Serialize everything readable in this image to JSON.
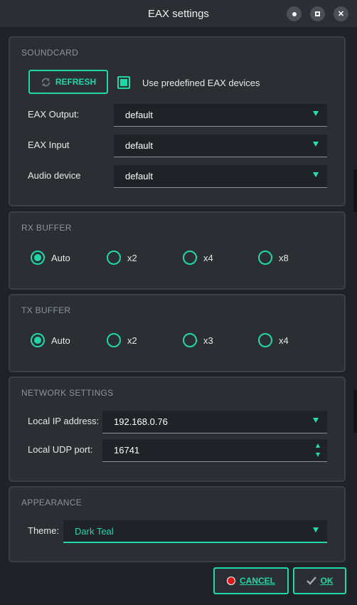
{
  "window": {
    "title": "EAX settings",
    "buttons": {
      "minimize": "●",
      "maximize": "■",
      "close": "✕"
    }
  },
  "soundcard": {
    "title": "SOUNDCARD",
    "refresh_label": "REFRESH",
    "use_predefined_label": "Use predefined EAX devices",
    "use_predefined_checked": true,
    "eax_output_label": "EAX Output:",
    "eax_output_value": "default",
    "eax_input_label": "EAX Input",
    "eax_input_value": "default",
    "audio_device_label": "Audio device",
    "audio_device_value": "default"
  },
  "rx_buffer": {
    "title": "RX BUFFER",
    "options": [
      "Auto",
      "x2",
      "x4",
      "x8"
    ],
    "selected": "Auto"
  },
  "tx_buffer": {
    "title": "TX BUFFER",
    "options": [
      "Auto",
      "x2",
      "x3",
      "x4"
    ],
    "selected": "Auto"
  },
  "network": {
    "title": "NETWORK SETTINGS",
    "ip_label": "Local IP address:",
    "ip_value": "192.168.0.76",
    "udp_label": "Local UDP port:",
    "udp_value": "16741"
  },
  "appearance": {
    "title": "APPEARANCE",
    "theme_label": "Theme:",
    "theme_value": "Dark Teal"
  },
  "dialog": {
    "cancel_label": "CANCEL",
    "ok_label": "OK"
  },
  "colors": {
    "accent": "#1ed8aa",
    "background": "#2b2f34",
    "field": "#1f2226",
    "cancel_icon": "#e01818"
  },
  "icons": {
    "refresh": "refresh-icon",
    "cancel": "stop-icon",
    "ok": "checkmark-icon"
  }
}
